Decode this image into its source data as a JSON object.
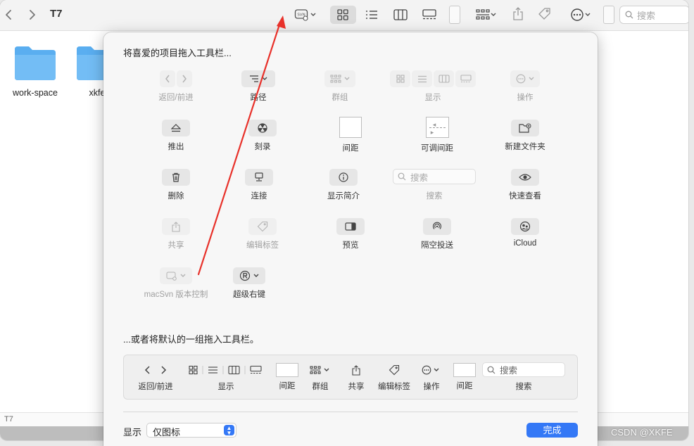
{
  "window": {
    "title": "T7",
    "status_path": "T7"
  },
  "toolbar": {
    "search_placeholder": "搜索",
    "svn_badge": "SVN"
  },
  "folders": [
    {
      "label": "work-space"
    },
    {
      "label": "xkfe"
    }
  ],
  "sheet": {
    "heading": "将喜爱的项目拖入工具栏...",
    "items": {
      "back_forward": "返回/前进",
      "path": "路径",
      "group": "群组",
      "view": "显示",
      "action": "操作",
      "eject": "推出",
      "burn": "刻录",
      "space": "间距",
      "flex_space": "可调间距",
      "new_folder": "新建文件夹",
      "delete": "删除",
      "connect": "连接",
      "get_info": "显示简介",
      "search": "搜索",
      "search_placeholder": "搜索",
      "quick_look": "快速查看",
      "share": "共享",
      "edit_tags": "编辑标签",
      "preview": "预览",
      "airdrop": "隔空投送",
      "icloud": "iCloud",
      "macsvn": "macSvn 版本控制",
      "super_right_click": "超级右键"
    },
    "default_heading": "...或者将默认的一组拖入工具栏。",
    "default_set": {
      "back_forward": "返回/前进",
      "view": "显示",
      "space": "间距",
      "group": "群组",
      "share": "共享",
      "edit_tags": "编辑标签",
      "action": "操作",
      "space2": "间距",
      "search": "搜索",
      "search_placeholder": "搜索"
    },
    "show_label": "显示",
    "show_value": "仅图标",
    "done": "完成"
  },
  "watermark": "CSDN @XKFE",
  "colors": {
    "accent": "#3478f6",
    "folder": "#5aaef0",
    "annotation_arrow": "#e8312a"
  }
}
